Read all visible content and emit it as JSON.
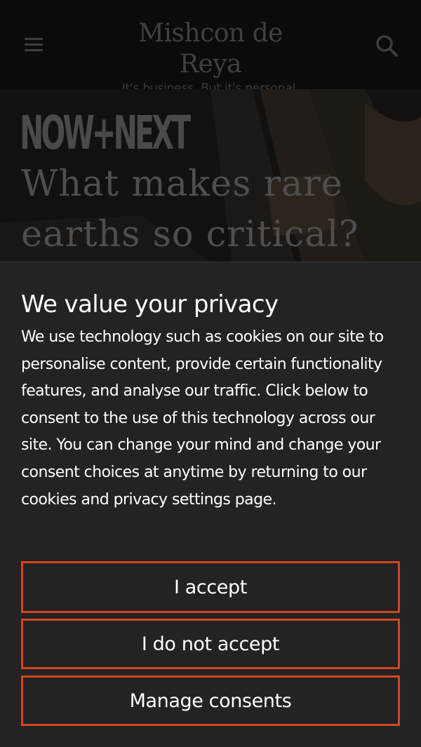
{
  "header": {
    "logo_name": "Mishcon de Reya",
    "logo_tagline": "It's business. But it's personal.",
    "menu_icon": "hamburger-menu-icon",
    "search_icon": "search-icon"
  },
  "hero": {
    "series_logo": "NOW+NEXT",
    "title": "What makes rare earths so critical?"
  },
  "consent": {
    "title": "We value your privacy",
    "body": "We use technology such as cookies on our site to personalise content, provide certain functionality features, and analyse our traffic. Click below to consent to the use of this technology across our site. You can change your mind and change your consent choices at anytime by returning to our cookies and privacy settings page.",
    "accept_label": "I accept",
    "decline_label": "I do not accept",
    "manage_label": "Manage consents"
  },
  "colors": {
    "accent": "#d4461f",
    "panel_background": "#232323",
    "header_background": "#0b0b0b"
  }
}
